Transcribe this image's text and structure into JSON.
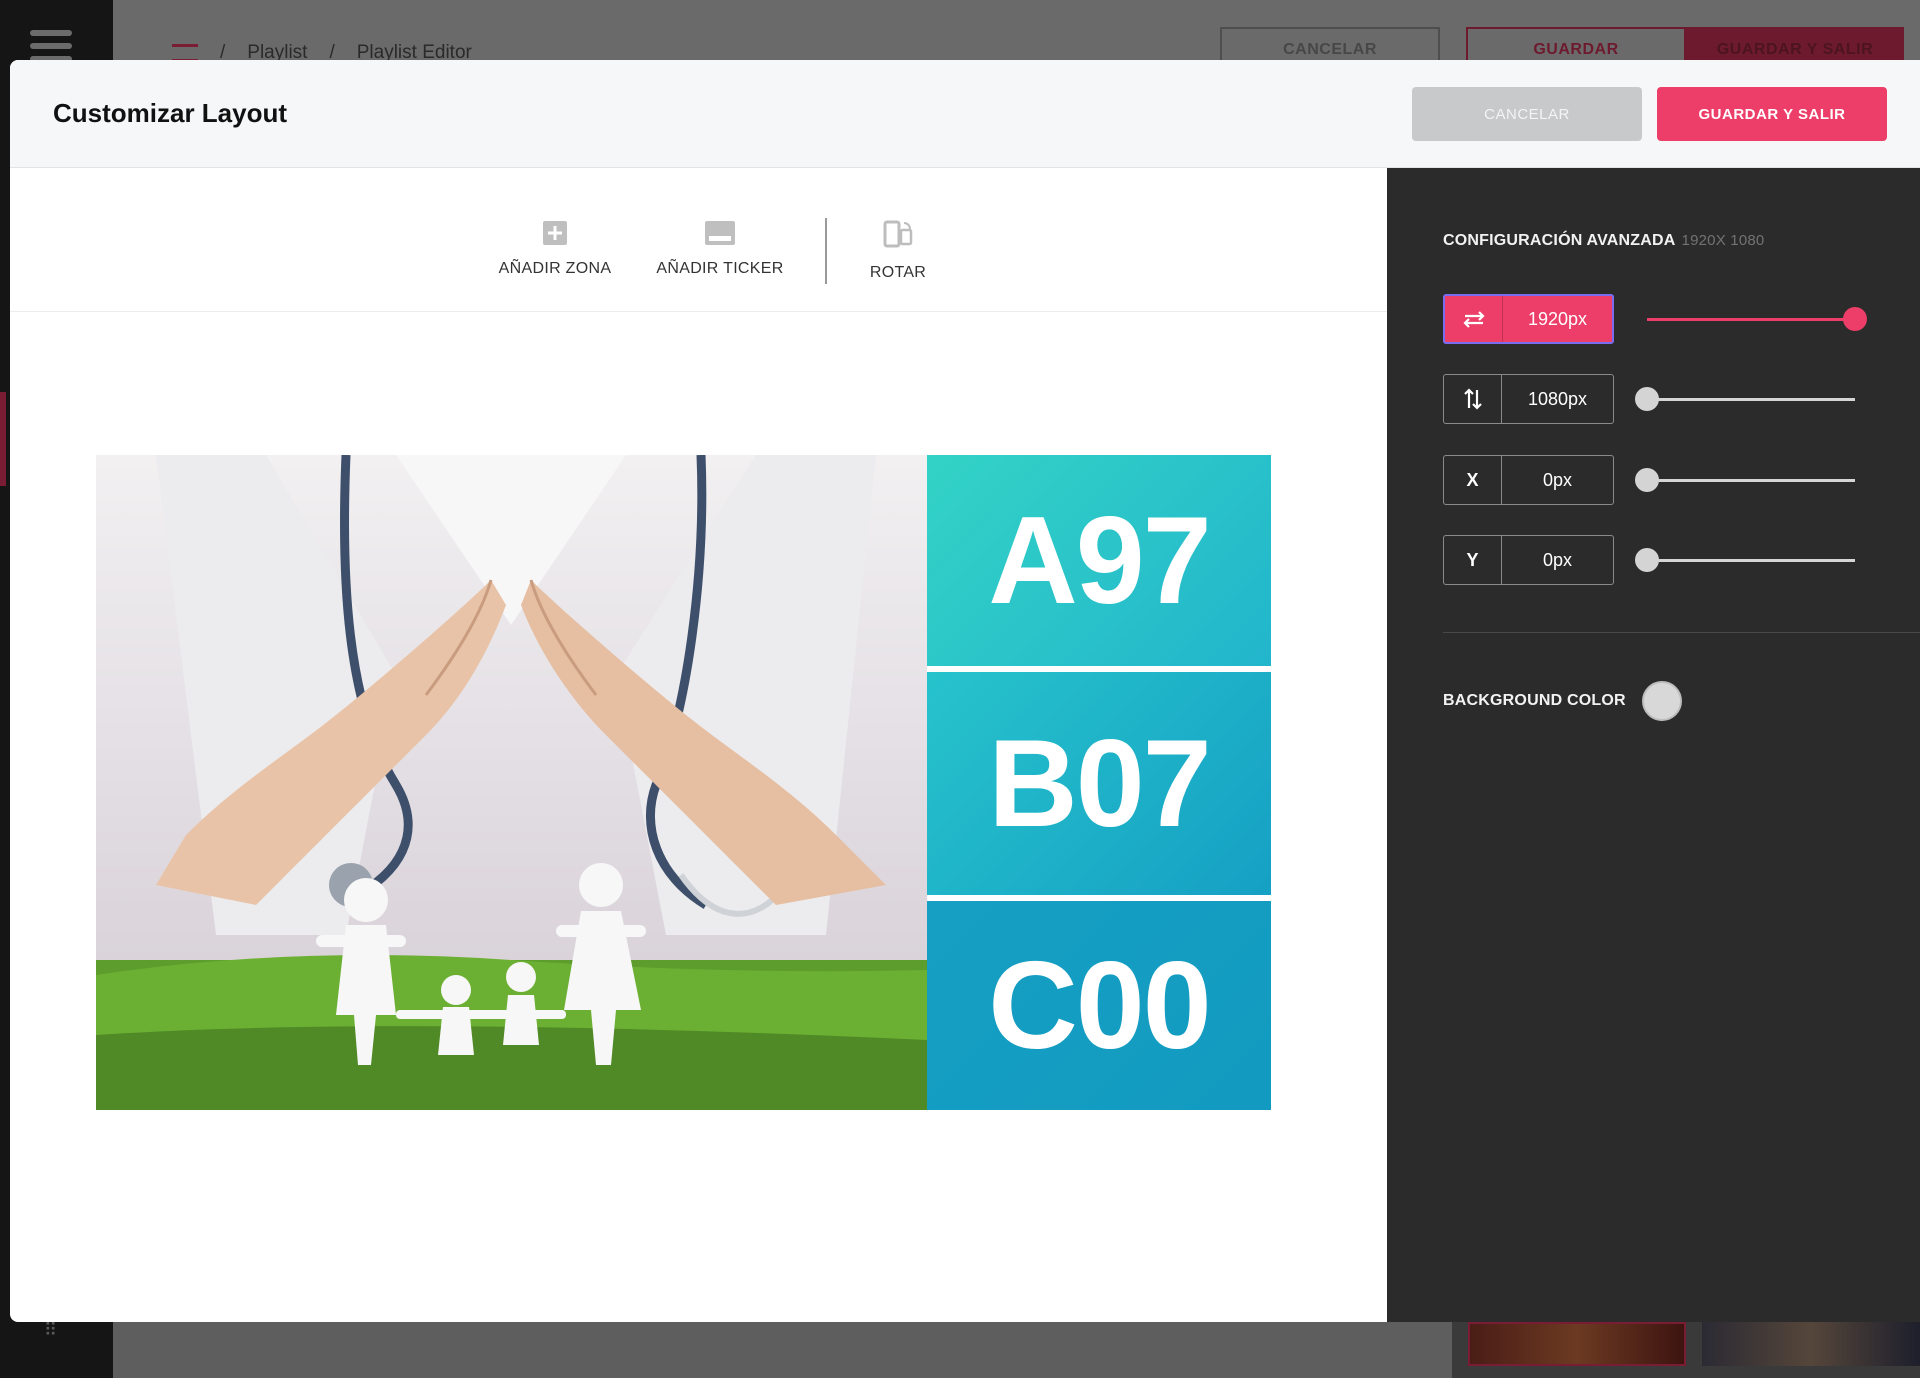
{
  "background": {
    "breadcrumb": [
      "Playlist",
      "/",
      "Playlist Editor"
    ],
    "sep": "/",
    "buttons": {
      "cancel": "CANCELAR",
      "save": "GUARDAR",
      "save_exit": "GUARDAR Y SALIR"
    }
  },
  "modal": {
    "title": "Customizar Layout",
    "cancel_label": "CANCELAR",
    "save_exit_label": "GUARDAR Y SALIR"
  },
  "toolbar": {
    "add_zone": "AÑADIR ZONA",
    "add_ticker": "AÑADIR TICKER",
    "rotate": "ROTAR"
  },
  "zones": [
    "A97",
    "B07",
    "C00"
  ],
  "panel": {
    "advanced_label": "CONFIGURACIÓN AVANZADA",
    "resolution": "1920X 1080",
    "width": {
      "icon": "horizontal-arrows-icon",
      "value": "1920px",
      "slider": 1.0
    },
    "height": {
      "icon": "vertical-arrows-icon",
      "value": "1080px",
      "slider": 0.0
    },
    "x": {
      "label": "X",
      "value": "0px",
      "slider": 0.0
    },
    "y": {
      "label": "Y",
      "value": "0px",
      "slider": 0.0
    },
    "background_color_label": "BACKGROUND COLOR",
    "background_color": "#d8d8d8"
  },
  "colors": {
    "accent": "#ec3e68",
    "panel": "#2b2b2b",
    "zone_teal": "#22b5cc"
  }
}
